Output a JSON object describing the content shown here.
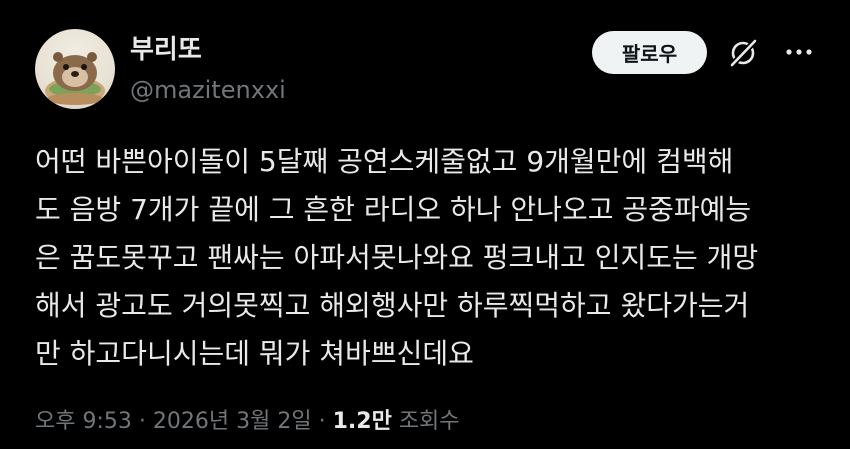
{
  "author": {
    "display_name": "부리또",
    "handle": "@mazitenxxi"
  },
  "actions": {
    "follow_label": "팔로우",
    "grok_icon": "grok-slash-icon",
    "more_icon": "more-horizontal-icon"
  },
  "tweet": {
    "text": "어떤 바쁜아이돌이 5달째 공연스케줄없고 9개월만에 컴백해\n도 음방 7개가 끝에 그 흔한 라디오 하나 안나오고 공중파예능\n은 꿈도못꾸고 팬싸는 아파서못나와요 펑크내고 인지도는 개망\n해서 광고도 거의못찍고 해외행사만 하루찍먹하고 왔다가는거\n만 하고다니시는데 뭐가 쳐바쁘신데요"
  },
  "meta": {
    "time": "오후 9:53",
    "separator": "·",
    "date": "2026년 3월 2일",
    "views_count": "1.2만",
    "views_label": "조회수"
  },
  "colors": {
    "background": "#000000",
    "text": "#e7e9ea",
    "secondary_text": "#71767b",
    "button_bg": "#eff3f4",
    "button_text": "#0f1419"
  }
}
